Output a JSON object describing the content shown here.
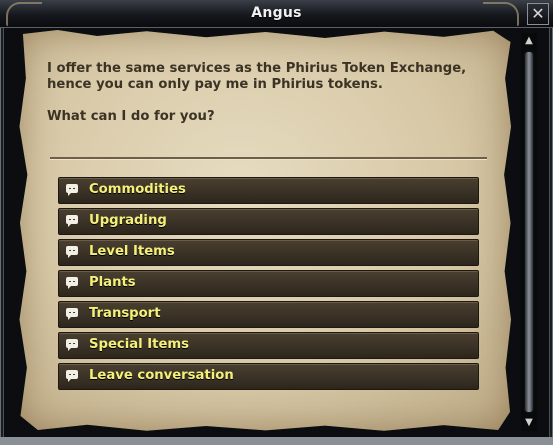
{
  "window": {
    "title": "Angus",
    "close_glyph": "✕"
  },
  "dialog": {
    "paragraphs": [
      "I offer the same services as the Phirius Token Exchange, hence you can only pay me in Phirius tokens.",
      "What can I do for you?"
    ],
    "options": [
      {
        "label": "Commodities",
        "icon": "speech-bubble-icon"
      },
      {
        "label": "Upgrading",
        "icon": "speech-bubble-icon"
      },
      {
        "label": "Level Items",
        "icon": "speech-bubble-icon"
      },
      {
        "label": "Plants",
        "icon": "speech-bubble-icon"
      },
      {
        "label": "Transport",
        "icon": "speech-bubble-icon"
      },
      {
        "label": "Special Items",
        "icon": "speech-bubble-icon"
      },
      {
        "label": "Leave conversation",
        "icon": "speech-bubble-icon"
      }
    ]
  },
  "scrollbar": {
    "up_glyph": "▲",
    "down_glyph": "▼"
  },
  "colors": {
    "option_text": "#f4f07a",
    "parchment": "#e7dcc1",
    "dialog_text": "#3b3324"
  }
}
